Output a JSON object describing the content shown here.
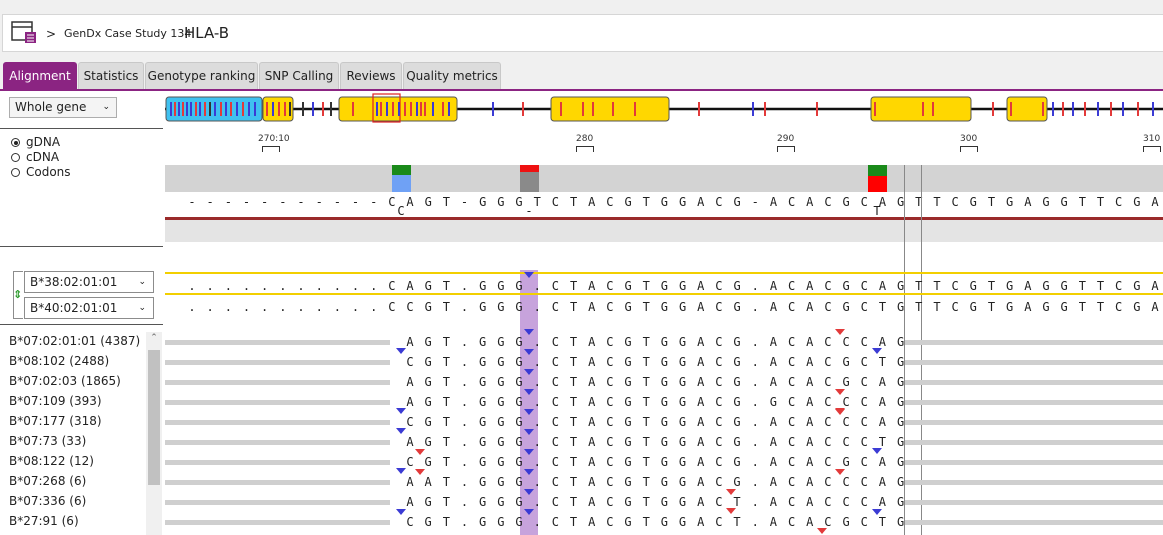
{
  "header": {
    "separator": ">",
    "project": "GenDx Case Study 134",
    "locus": "HLA-B"
  },
  "tabs": [
    {
      "label": "Alignment",
      "active": true
    },
    {
      "label": "Statistics",
      "active": false
    },
    {
      "label": "Genotype ranking",
      "active": false
    },
    {
      "label": "SNP Calling",
      "active": false
    },
    {
      "label": "Reviews",
      "active": false
    },
    {
      "label": "Quality metrics",
      "active": false
    }
  ],
  "region_select": {
    "value": "Whole gene"
  },
  "view_modes": [
    {
      "label": "gDNA",
      "selected": true
    },
    {
      "label": "cDNA",
      "selected": false
    },
    {
      "label": "Codons",
      "selected": false
    }
  ],
  "ruler": [
    {
      "label": "270:10"
    },
    {
      "label": "280"
    },
    {
      "label": "290"
    },
    {
      "label": "300"
    },
    {
      "label": "310"
    }
  ],
  "reference": {
    "top": "- - - - - - - - - - - C A G T - G G G T C T A C G T G G A C G - A C A C G C A G T T C G T G A G G T T C G A",
    "bottom": "                      C            -                        T                      "
  },
  "genotype": {
    "allele1": {
      "label": "B*38:02:01:01",
      "seq": ". . . . . . . . . . . C A G T . G G G . C T A C G T G G A C G . A C A C G C A G T T C G T G A G G T T C G A"
    },
    "allele2": {
      "label": "B*40:02:01:01",
      "seq": ". . . . . . . . . . . C C G T . G G G . C T A C G T G G A C G . A C A C G C T G T T C G T G A G G T T C G A"
    }
  },
  "candidates": [
    {
      "label": "B*07:02:01:01 (4387)",
      "seq": "A G T . G G G . C T A C G T G G A C G . A C A C C C A G"
    },
    {
      "label": "B*08:102 (2488)",
      "seq": "C G T . G G G . C T A C G T G G A C G . A C A C G C T G"
    },
    {
      "label": "B*07:02:03 (1865)",
      "seq": "A G T . G G G . C T A C G T G G A C G . A C A C G C A G"
    },
    {
      "label": "B*07:109 (393)",
      "seq": "A G T . G G G . C T A C G T G G A C G . G C A C C C A G"
    },
    {
      "label": "B*07:177 (318)",
      "seq": "C G T . G G G . C T A C G T G G A C G . A C A C C C A G"
    },
    {
      "label": "B*07:73 (33)",
      "seq": "A G T . G G G . C T A C G T G G A C G . A C A C C C T G"
    },
    {
      "label": "B*08:122 (12)",
      "seq": "C G T . G G G . C T A C G T G G A C G . A C A C G C A G"
    },
    {
      "label": "B*07:268 (6)",
      "seq": "A A T . G G G . C T A C G T G G A C G . A C A C C C A G"
    },
    {
      "label": "B*07:336 (6)",
      "seq": "A G T . G G G . C T A C G T G G A C T . A C A C C C A G"
    },
    {
      "label": "B*27:91 (6)",
      "seq": "C G T . G G G . C T A C G T G G A C T . A C A C G C T G"
    }
  ],
  "colors": {
    "accent": "#8b2482",
    "exon_yellow": "#ffd700",
    "intron_blue": "#3fc1f0",
    "green": "#1a8a1a",
    "red": "#ff0000"
  }
}
